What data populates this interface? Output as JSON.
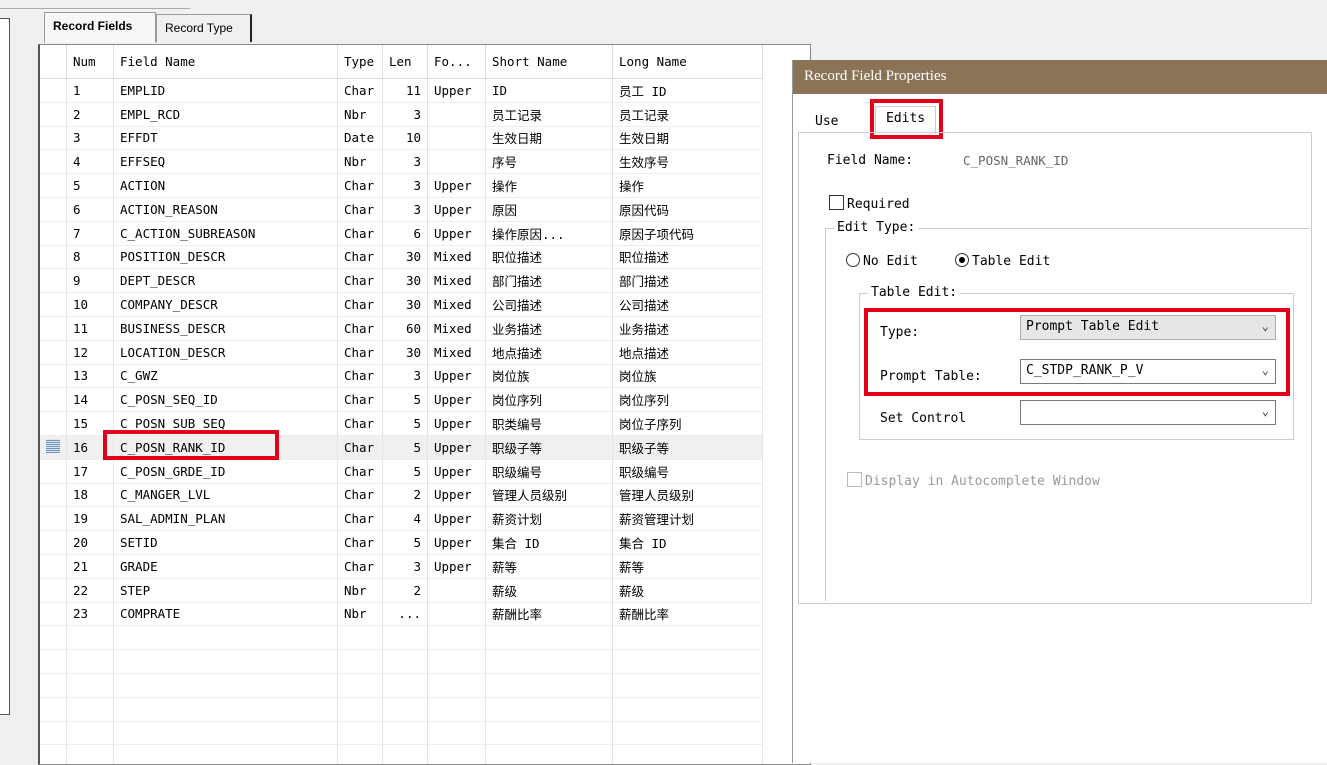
{
  "record_tabs": [
    "Record Fields",
    "Record Type"
  ],
  "grid": {
    "columns": [
      "Num",
      "Field Name",
      "Type",
      "Len",
      "Fo...",
      "Short Name",
      "Long Name"
    ],
    "selected_row": 16,
    "rows": [
      [
        "1",
        "EMPLID",
        "Char",
        "11",
        "Upper",
        "ID",
        "员工 ID"
      ],
      [
        "2",
        "EMPL_RCD",
        "Nbr",
        "3",
        "",
        "员工记录",
        "员工记录"
      ],
      [
        "3",
        "EFFDT",
        "Date",
        "10",
        "",
        "生效日期",
        "生效日期"
      ],
      [
        "4",
        "EFFSEQ",
        "Nbr",
        "3",
        "",
        "序号",
        "生效序号"
      ],
      [
        "5",
        "ACTION",
        "Char",
        "3",
        "Upper",
        "操作",
        "操作"
      ],
      [
        "6",
        "ACTION_REASON",
        "Char",
        "3",
        "Upper",
        "原因",
        "原因代码"
      ],
      [
        "7",
        "C_ACTION_SUBREASON",
        "Char",
        "6",
        "Upper",
        "操作原因...",
        "原因子项代码"
      ],
      [
        "8",
        "POSITION_DESCR",
        "Char",
        "30",
        "Mixed",
        "职位描述",
        "职位描述"
      ],
      [
        "9",
        "DEPT_DESCR",
        "Char",
        "30",
        "Mixed",
        "部门描述",
        "部门描述"
      ],
      [
        "10",
        "COMPANY_DESCR",
        "Char",
        "30",
        "Mixed",
        "公司描述",
        "公司描述"
      ],
      [
        "11",
        "BUSINESS_DESCR",
        "Char",
        "60",
        "Mixed",
        "业务描述",
        "业务描述"
      ],
      [
        "12",
        "LOCATION_DESCR",
        "Char",
        "30",
        "Mixed",
        "地点描述",
        "地点描述"
      ],
      [
        "13",
        "C_GWZ",
        "Char",
        "3",
        "Upper",
        "岗位族",
        "岗位族"
      ],
      [
        "14",
        "C_POSN_SEQ_ID",
        "Char",
        "5",
        "Upper",
        "岗位序列",
        "岗位序列"
      ],
      [
        "15",
        "C_POSN_SUB_SEQ",
        "Char",
        "5",
        "Upper",
        "职类编号",
        "岗位子序列"
      ],
      [
        "16",
        "C_POSN_RANK_ID",
        "Char",
        "5",
        "Upper",
        "职级子等",
        "职级子等"
      ],
      [
        "17",
        "C_POSN_GRDE_ID",
        "Char",
        "5",
        "Upper",
        "职级编号",
        "职级编号"
      ],
      [
        "18",
        "C_MANGER_LVL",
        "Char",
        "2",
        "Upper",
        "管理人员级别",
        "管理人员级别"
      ],
      [
        "19",
        "SAL_ADMIN_PLAN",
        "Char",
        "4",
        "Upper",
        "薪资计划",
        "薪资管理计划"
      ],
      [
        "20",
        "SETID",
        "Char",
        "5",
        "Upper",
        "集合 ID",
        "集合 ID"
      ],
      [
        "21",
        "GRADE",
        "Char",
        "3",
        "Upper",
        "薪等",
        "薪等"
      ],
      [
        "22",
        "STEP",
        "Nbr",
        "2",
        "",
        "薪级",
        "薪级"
      ],
      [
        "23",
        "COMPRATE",
        "Nbr",
        "...",
        "",
        "薪酬比率",
        "薪酬比率"
      ]
    ]
  },
  "dialog": {
    "title": "Record Field Properties",
    "tabs": [
      "Use",
      "Edits"
    ],
    "field_name_label": "Field Name:",
    "field_name_value": "C_POSN_RANK_ID",
    "required_label": "Required",
    "edit_type_label": "Edit Type:",
    "no_edit_label": "No Edit",
    "table_edit_label": "Table Edit",
    "table_edit_group": "Table Edit:",
    "type_label": "Type:",
    "type_value": "Prompt Table Edit",
    "prompt_table_label": "Prompt Table:",
    "prompt_table_value": "C_STDP_RANK_P_V",
    "set_control_label": "Set Control",
    "set_control_value": "",
    "autocomplete_label": "Display in Autocomplete Window"
  },
  "colors": {
    "title_bar": "#8b7355",
    "highlight": "#e4001b"
  }
}
